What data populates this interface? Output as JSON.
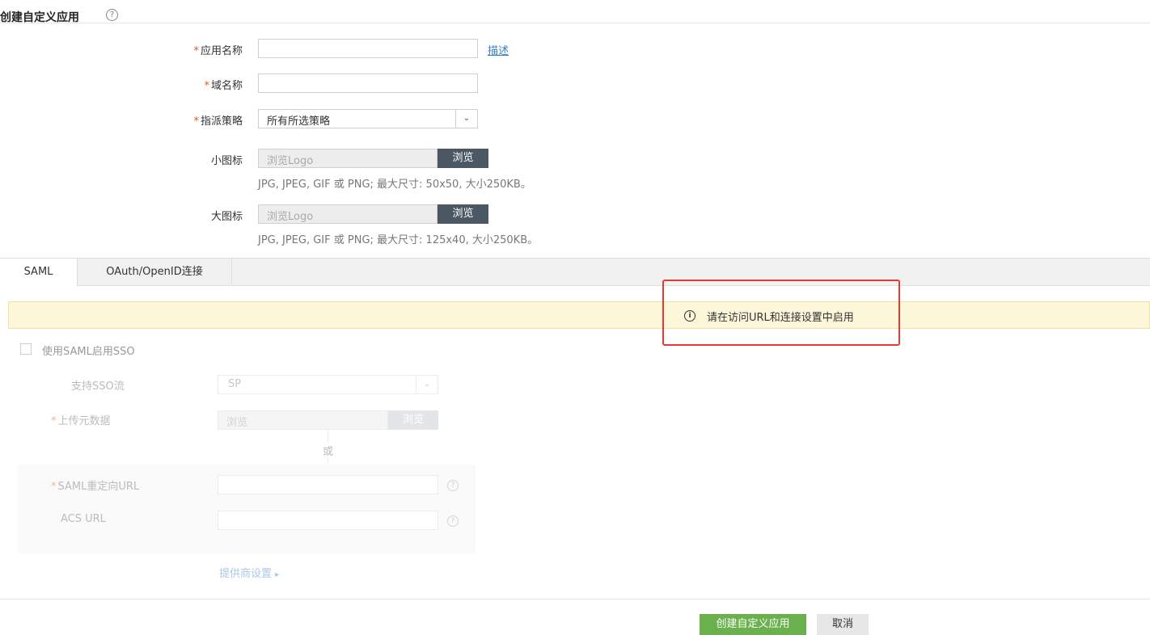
{
  "header": {
    "title": "创建自定义应用",
    "help_glyph": "?"
  },
  "form": {
    "app_name": {
      "label": "应用名称",
      "required": "*",
      "value": "",
      "side_link": "描述"
    },
    "domain_name": {
      "label": "域名称",
      "required": "*",
      "value": ""
    },
    "assign_policy": {
      "label": "指派策略",
      "required": "*",
      "selected": "所有所选策略",
      "arrow": "⌄"
    },
    "small_icon": {
      "label": "小图标",
      "placeholder": "浏览Logo",
      "browse": "浏览",
      "hint": "JPG, JPEG, GIF 或 PNG; 最大尺寸: 50x50, 大小250KB。"
    },
    "large_icon": {
      "label": "大图标",
      "placeholder": "浏览Logo",
      "browse": "浏览",
      "hint": "JPG, JPEG, GIF 或 PNG; 最大尺寸: 125x40, 大小250KB。"
    }
  },
  "tabs": [
    {
      "label": "SAML",
      "active": true
    },
    {
      "label": "OAuth/OpenID连接",
      "active": false
    }
  ],
  "banner": {
    "icon": "i",
    "text": "请在访问URL和连接设置中启用"
  },
  "saml": {
    "enable_checkbox_label": "使用SAML启用SSO",
    "sso_flow": {
      "label": "支持SSO流",
      "selected": "SP",
      "arrow": "⌄"
    },
    "upload_metadata": {
      "label": "上传元数据",
      "required": "*",
      "placeholder": "浏览",
      "browse": "浏览"
    },
    "or_text": "或",
    "redirect_url": {
      "label": "SAML重定向URL",
      "required": "*",
      "help_glyph": "?"
    },
    "acs_url": {
      "label": "ACS URL",
      "help_glyph": "?"
    },
    "provider_settings": "提供商设置",
    "provider_arrow": "▸"
  },
  "footer": {
    "create_button": "创建自定义应用",
    "cancel_button": "取消"
  },
  "colors": {
    "primary": "#6ab04c",
    "browse": "#4b5763",
    "banner_bg": "#fdf7d9",
    "highlight": "#e53935"
  }
}
